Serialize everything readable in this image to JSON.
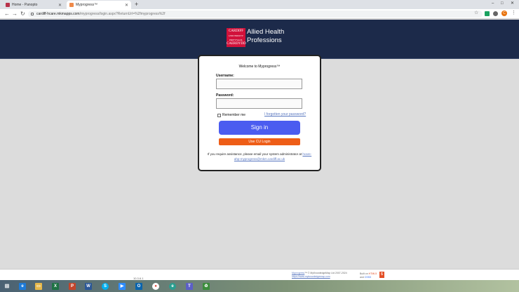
{
  "browser": {
    "tabs": [
      {
        "title": "Home - Panopto",
        "favicon_color": "#b8324a"
      },
      {
        "title": "Myprogress™",
        "favicon_color": "#ef8a4a"
      }
    ],
    "new_tab": "+",
    "window_controls": [
      "–",
      "□",
      "✕"
    ],
    "url_host": "cardiff-hcare.mkmapps.com",
    "url_path": "/myprogress/login.aspx?ReturnUrl=%2fmyprogress%2f",
    "profile_initial": "C"
  },
  "header": {
    "logo_lines": [
      "CARDIFF",
      "UNIVERSITY",
      "PRIFYSGOL",
      "CAERDYDD"
    ],
    "title_line1": "Allied Health",
    "title_line2": "Professions"
  },
  "login": {
    "welcome": "Welcome to Myprogress™",
    "username_label": "Username:",
    "username_value": "",
    "password_label": "Password:",
    "password_value": "",
    "remember_label": "Remember me",
    "forgot_link": "I forgotten your password?",
    "signin_label": "Sign in",
    "cu_login_label": "Use CU Login",
    "help_text": "If you require assistance, please email your system administrator at",
    "help_email": "hcare-ahp-myprogress@mkm.cardiff.ac.uk"
  },
  "footer": {
    "version": "10.3.6.1",
    "product_link": "Myprogress",
    "copyright": "™ © MyKnowledgeMap Ltd 2007-2024",
    "site_link": "https://www.myknowledgemap.com",
    "built_line1": "Built on",
    "built_html": "HTML5",
    "built_line2": "and",
    "built_css": "CSS3",
    "html5_badge": "5"
  },
  "taskbar": {
    "start_icon": "windows-start-icon",
    "apps": [
      {
        "name": "internet-explorer-icon",
        "glyph": "e",
        "color": "#1e7ad6"
      },
      {
        "name": "file-explorer-icon",
        "glyph": "▭",
        "color": "#e6b84a"
      },
      {
        "name": "excel-icon",
        "glyph": "X",
        "color": "#1f7244"
      },
      {
        "name": "powerpoint-icon",
        "glyph": "P",
        "color": "#c2452b"
      },
      {
        "name": "word-icon",
        "glyph": "W",
        "color": "#2b5797"
      },
      {
        "name": "skype-icon",
        "glyph": "S",
        "color": "#00aff0"
      },
      {
        "name": "zoom-icon",
        "glyph": "▶",
        "color": "#2d8cff"
      },
      {
        "name": "outlook-icon",
        "glyph": "O",
        "color": "#0a64ad"
      },
      {
        "name": "chrome-icon",
        "glyph": "●",
        "color": "#db4437"
      },
      {
        "name": "edge-icon",
        "glyph": "e",
        "color": "#2a9d8f"
      },
      {
        "name": "teams-icon",
        "glyph": "T",
        "color": "#5b5fc7"
      },
      {
        "name": "recycle-icon",
        "glyph": "♻",
        "color": "#3c8d3c"
      }
    ]
  }
}
